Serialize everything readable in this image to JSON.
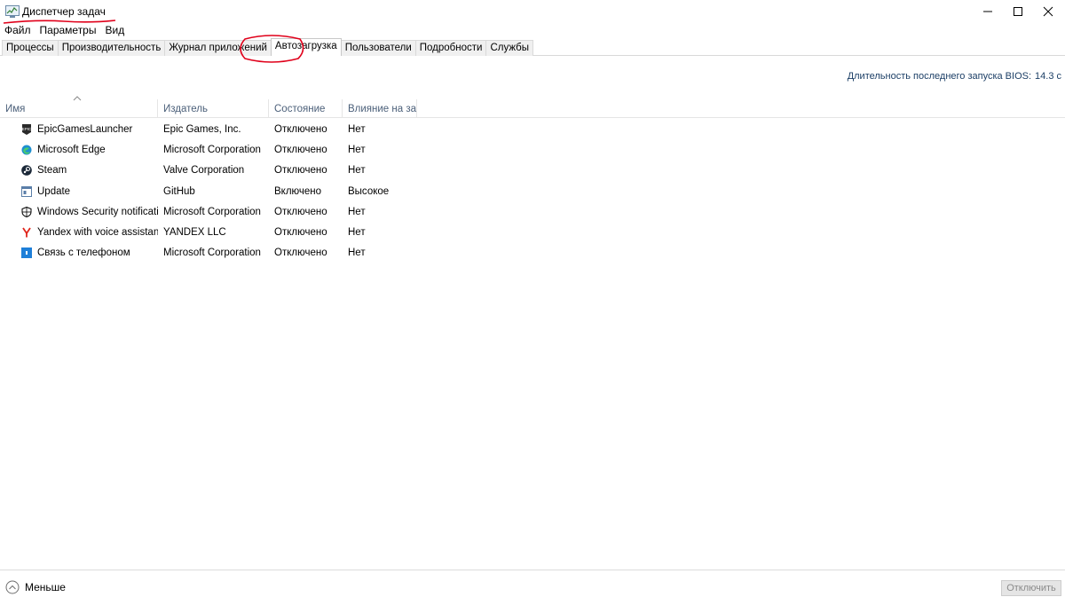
{
  "window": {
    "title": "Диспетчер задач"
  },
  "menu": [
    "Файл",
    "Параметры",
    "Вид"
  ],
  "tabs": [
    {
      "label": "Процессы"
    },
    {
      "label": "Производительность"
    },
    {
      "label": "Журнал приложений"
    },
    {
      "label": "Автозагрузка"
    },
    {
      "label": "Пользователи"
    },
    {
      "label": "Подробности"
    },
    {
      "label": "Службы"
    }
  ],
  "active_tab": "Автозагрузка",
  "bios": {
    "label": "Длительность последнего запуска BIOS:",
    "value": "14.3 с"
  },
  "columns": [
    "Имя",
    "Издатель",
    "Состояние",
    "Влияние на за..."
  ],
  "rows": [
    {
      "name": "EpicGamesLauncher",
      "publisher": "Epic Games, Inc.",
      "state": "Отключено",
      "impact": "Нет",
      "icon": "epic-games-icon"
    },
    {
      "name": "Microsoft Edge",
      "publisher": "Microsoft Corporation",
      "state": "Отключено",
      "impact": "Нет",
      "icon": "edge-icon"
    },
    {
      "name": "Steam",
      "publisher": "Valve Corporation",
      "state": "Отключено",
      "impact": "Нет",
      "icon": "steam-icon"
    },
    {
      "name": "Update",
      "publisher": "GitHub",
      "state": "Включено",
      "impact": "Высокое",
      "icon": "update-icon"
    },
    {
      "name": "Windows Security notificati...",
      "publisher": "Microsoft Corporation",
      "state": "Отключено",
      "impact": "Нет",
      "icon": "shield-icon"
    },
    {
      "name": "Yandex with voice assistant ...",
      "publisher": "YANDEX LLC",
      "state": "Отключено",
      "impact": "Нет",
      "icon": "yandex-icon"
    },
    {
      "name": "Связь с телефоном",
      "publisher": "Microsoft Corporation",
      "state": "Отключено",
      "impact": "Нет",
      "icon": "phone-link-icon"
    }
  ],
  "footer": {
    "fewer_label": "Меньше",
    "disable_label": "Отключить"
  },
  "colors": {
    "annotation_red": "#e0001a",
    "header_text": "#4c607a",
    "bios_text": "#1c3f66"
  }
}
